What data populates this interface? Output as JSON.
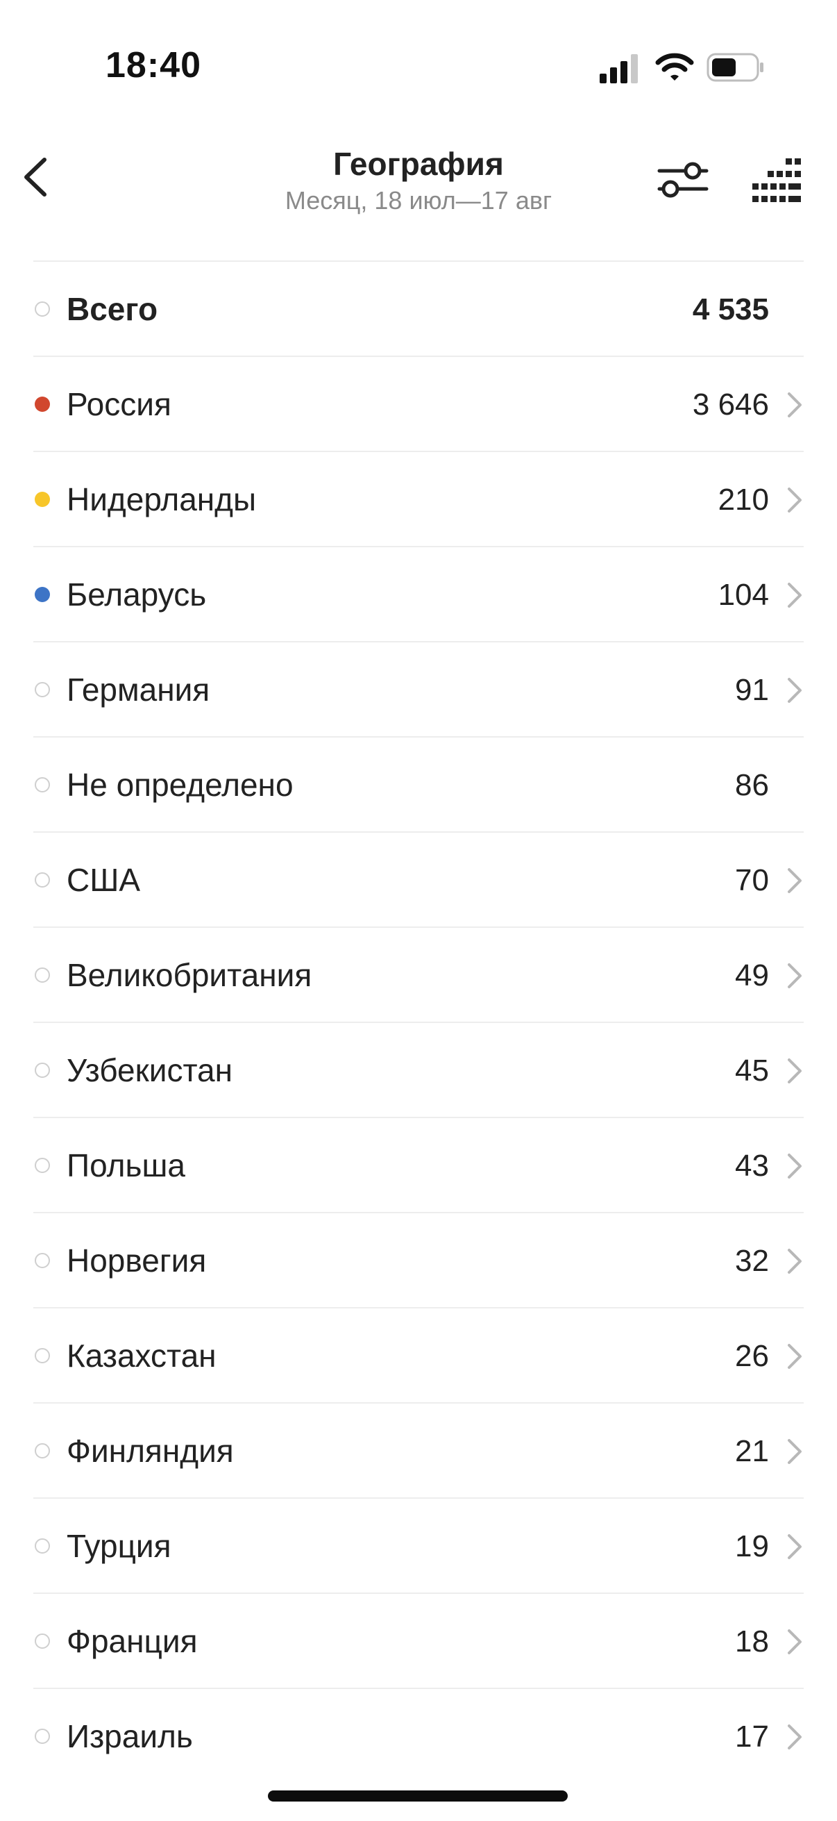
{
  "status_bar": {
    "time": "18:40",
    "icons": [
      "signal-icon",
      "wifi-icon",
      "battery-icon"
    ]
  },
  "header": {
    "title": "География",
    "subtitle": "Месяц, 18 июл—17 авг",
    "icons": [
      "back-arrow-icon",
      "filter-sliders-icon",
      "grid-dots-icon"
    ]
  },
  "colors": {
    "russia": "#d1472e",
    "netherlands": "#f7c62a",
    "belarus": "#3d74c6",
    "divider": "#ededed",
    "text_secondary": "#8a8a8a"
  },
  "rows": [
    {
      "label": "Всего",
      "value": "4 535",
      "total": true,
      "chevron": false,
      "dot_color": null
    },
    {
      "label": "Россия",
      "value": "3 646",
      "chevron": true,
      "dot_color": "#d1472e"
    },
    {
      "label": "Нидерланды",
      "value": "210",
      "chevron": true,
      "dot_color": "#f7c62a"
    },
    {
      "label": "Беларусь",
      "value": "104",
      "chevron": true,
      "dot_color": "#3d74c6"
    },
    {
      "label": "Германия",
      "value": "91",
      "chevron": true,
      "dot_color": null
    },
    {
      "label": "Не определено",
      "value": "86",
      "chevron": false,
      "dot_color": null
    },
    {
      "label": "США",
      "value": "70",
      "chevron": true,
      "dot_color": null
    },
    {
      "label": "Великобритания",
      "value": "49",
      "chevron": true,
      "dot_color": null
    },
    {
      "label": "Узбекистан",
      "value": "45",
      "chevron": true,
      "dot_color": null
    },
    {
      "label": "Польша",
      "value": "43",
      "chevron": true,
      "dot_color": null
    },
    {
      "label": "Норвегия",
      "value": "32",
      "chevron": true,
      "dot_color": null
    },
    {
      "label": "Казахстан",
      "value": "26",
      "chevron": true,
      "dot_color": null
    },
    {
      "label": "Финляндия",
      "value": "21",
      "chevron": true,
      "dot_color": null
    },
    {
      "label": "Турция",
      "value": "19",
      "chevron": true,
      "dot_color": null
    },
    {
      "label": "Франция",
      "value": "18",
      "chevron": true,
      "dot_color": null
    },
    {
      "label": "Израиль",
      "value": "17",
      "chevron": true,
      "dot_color": null
    }
  ]
}
